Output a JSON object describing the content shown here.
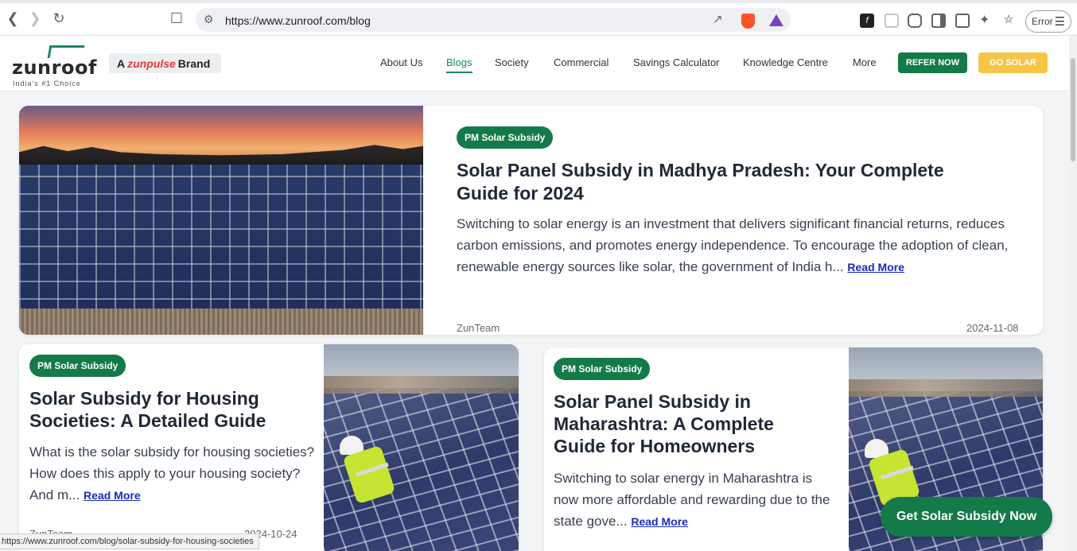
{
  "browser": {
    "url": "https://www.zunroof.com/blog",
    "error_label": "Error",
    "status_url": "https://www.zunroof.com/blog/solar-subsidy-for-housing-societies"
  },
  "header": {
    "logo_text": "zunroof",
    "logo_tagline": "India's #1 Choice",
    "brand_prefix": "A",
    "brand_name": "zunpulse",
    "brand_suffix": "Brand",
    "nav": [
      "About Us",
      "Blogs",
      "Society",
      "Commercial",
      "Savings Calculator",
      "Knowledge Centre",
      "More"
    ],
    "active_nav": "Blogs",
    "refer_label": "REFER NOW",
    "go_solar_label": "GO SOLAR"
  },
  "featured": {
    "badge": "PM Solar Subsidy",
    "title": "Solar Panel Subsidy in Madhya Pradesh: Your Complete Guide for 2024",
    "excerpt": "Switching to solar energy is an investment that delivers significant financial returns, reduces carbon emissions, and promotes energy independence. To encourage the adoption of clean, renewable energy sources like solar, the government of India h...",
    "read_more": "Read More",
    "author": "ZunTeam",
    "date": "2024-11-08"
  },
  "posts": [
    {
      "badge": "PM Solar Subsidy",
      "title": "Solar Subsidy for Housing Societies: A Detailed Guide",
      "excerpt": "What is the solar subsidy for housing societies? How does this apply to your housing society? And m...",
      "read_more": "Read More",
      "author": "ZunTeam",
      "date": "2024-10-24"
    },
    {
      "badge": "PM Solar Subsidy",
      "title": "Solar Panel Subsidy in Maharashtra: A Complete Guide for Homeowners",
      "excerpt": "Switching to solar energy in Maharashtra is now more affordable and rewarding due to the state gove...",
      "read_more": "Read More"
    }
  ],
  "cta_label": "Get Solar Subsidy Now",
  "colors": {
    "brand_green": "#157a4a",
    "go_solar_yellow": "#f6c545",
    "link_blue": "#1a2bbf"
  }
}
